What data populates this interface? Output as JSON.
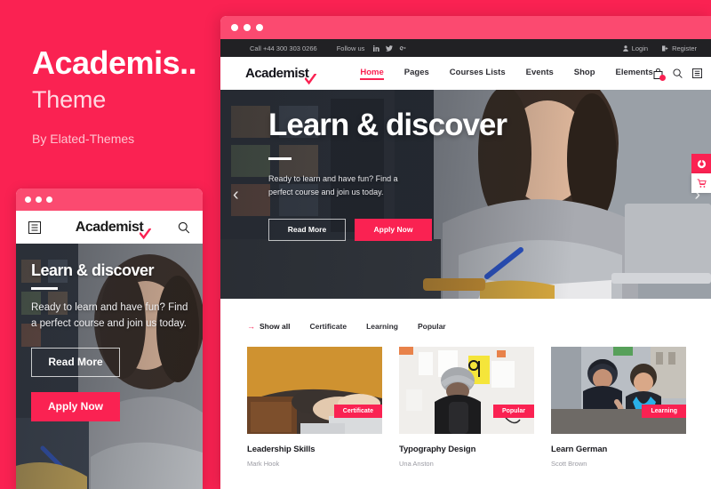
{
  "promo": {
    "title": "Academis..",
    "subtitle": "Theme",
    "byline": "By Elated-Themes",
    "brand_color": "#fa2252"
  },
  "mobile_mockup": {
    "titlebar_color": "#fb4a70",
    "nav": {
      "menu_icon": "hamburger-menu-icon",
      "logo": "Academist",
      "search_icon": "search-icon"
    },
    "hero": {
      "title": "Learn & discover",
      "text": "Ready to learn and have fun? Find a perfect course and join us today.",
      "button_outline": "Read More",
      "button_fill": "Apply Now"
    }
  },
  "desktop_mockup": {
    "titlebar_color": "#fb4a70",
    "topbar": {
      "phone": "Call +44 300 303 0266",
      "follow_label": "Follow us",
      "socials": [
        "linkedin-icon",
        "twitter-icon",
        "google-plus-icon"
      ],
      "login": "Login",
      "register": "Register"
    },
    "header": {
      "logo": "Academist",
      "nav": [
        {
          "label": "Home",
          "active": true
        },
        {
          "label": "Pages",
          "active": false
        },
        {
          "label": "Courses Lists",
          "active": false
        },
        {
          "label": "Events",
          "active": false
        },
        {
          "label": "Shop",
          "active": false
        },
        {
          "label": "Elements",
          "active": false
        }
      ],
      "icons": [
        "shopping-bag-icon",
        "search-icon",
        "sidebar-menu-icon"
      ],
      "cart_badge_color": "#fa2252"
    },
    "hero": {
      "title": "Learn & discover",
      "text": "Ready to learn and have fun? Find a perfect course and join us today.",
      "button_outline": "Read More",
      "button_fill": "Apply Now",
      "prev_arrow": "‹",
      "next_arrow": "›"
    },
    "side_widgets": [
      {
        "icon": "settings-circle-icon",
        "style": "pink"
      },
      {
        "icon": "cart-icon",
        "style": "white"
      }
    ],
    "courses": {
      "filters": [
        {
          "label": "Show all",
          "active": true
        },
        {
          "label": "Certificate",
          "active": false
        },
        {
          "label": "Learning",
          "active": false
        },
        {
          "label": "Popular",
          "active": false
        }
      ],
      "cards": [
        {
          "title": "Leadership Skills",
          "author": "Mark Hook",
          "badge": "Certificate"
        },
        {
          "title": "Typography Design",
          "author": "Una Anston",
          "badge": "Popular"
        },
        {
          "title": "Learn German",
          "author": "Scott Brown",
          "badge": "Learning"
        }
      ]
    }
  }
}
